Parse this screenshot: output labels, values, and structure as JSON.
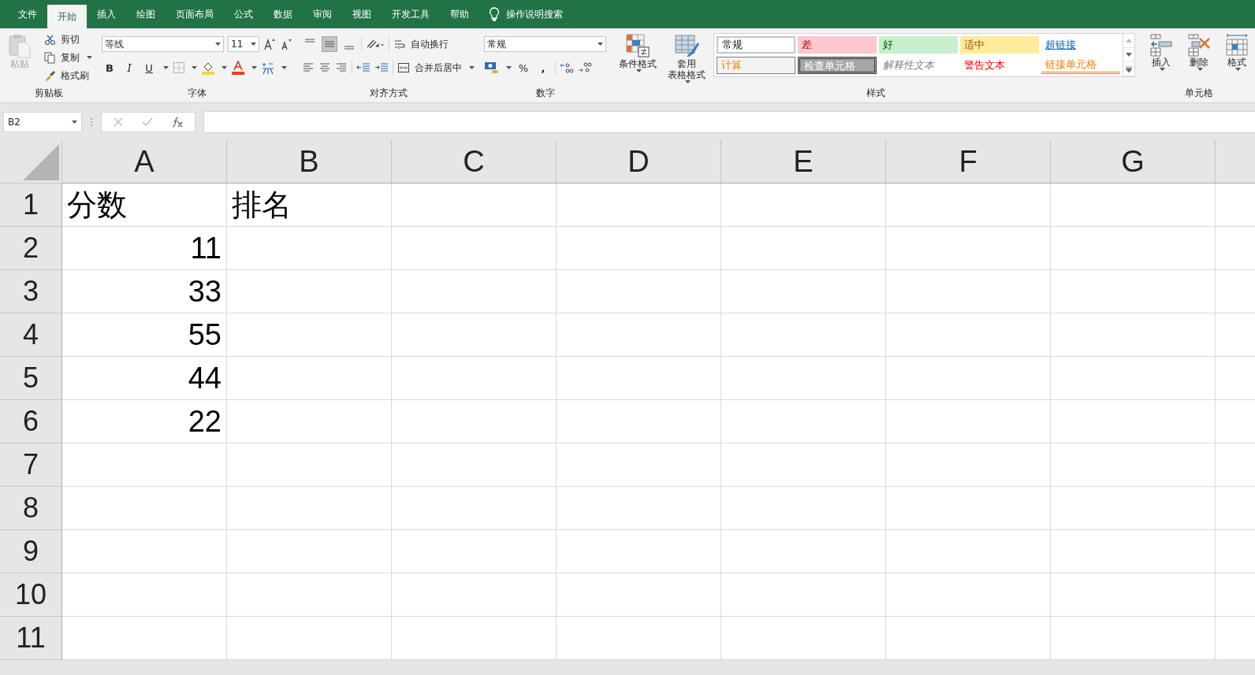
{
  "tabs": [
    {
      "label": "文件",
      "selected": false
    },
    {
      "label": "开始",
      "selected": true
    },
    {
      "label": "插入",
      "selected": false
    },
    {
      "label": "绘图",
      "selected": false
    },
    {
      "label": "页面布局",
      "selected": false
    },
    {
      "label": "公式",
      "selected": false
    },
    {
      "label": "数据",
      "selected": false
    },
    {
      "label": "审阅",
      "selected": false
    },
    {
      "label": "视图",
      "selected": false
    },
    {
      "label": "开发工具",
      "selected": false
    },
    {
      "label": "帮助",
      "selected": false
    }
  ],
  "tell_me": "操作说明搜索",
  "clipboard": {
    "label": "剪贴板",
    "paste": {
      "label": "粘贴",
      "disabled": true
    },
    "cut": "剪切",
    "copy": "复制",
    "format_painter": "格式刷"
  },
  "font": {
    "label": "字体",
    "name": "等线",
    "size": "11",
    "bold": "B",
    "italic": "I",
    "underline": "U"
  },
  "alignment": {
    "label": "对齐方式",
    "wrap": "自动换行",
    "merge": "合并后居中",
    "vertical": [
      {
        "selected": false
      },
      {
        "selected": true
      },
      {
        "selected": false
      }
    ]
  },
  "number": {
    "label": "数字",
    "format": "常规",
    "percent": "%",
    "comma": ","
  },
  "styles": {
    "label": "样式",
    "conditional": "条件格式",
    "table_lines": [
      "套用",
      "表格格式"
    ],
    "cell_styles": [
      {
        "text": "常规",
        "kind": "normal"
      },
      {
        "text": "差",
        "kind": "bad"
      },
      {
        "text": "好",
        "kind": "good"
      },
      {
        "text": "适中",
        "kind": "neutral"
      },
      {
        "text": "超链接",
        "kind": "hyperlink"
      },
      {
        "text": "计算",
        "kind": "calculation"
      },
      {
        "text": "检查单元格",
        "kind": "check"
      },
      {
        "text": "解释性文本",
        "kind": "explanatory"
      },
      {
        "text": "警告文本",
        "kind": "warning"
      },
      {
        "text": "链接单元格",
        "kind": "linked"
      }
    ]
  },
  "cells": {
    "label": "单元格",
    "insert": "插入",
    "delete": "删除",
    "format": "格式"
  },
  "name_box": "B2",
  "columns": [
    "A",
    "B",
    "C",
    "D",
    "E",
    "F",
    "G"
  ],
  "rows": [
    {
      "number": "1",
      "cells": [
        {
          "text": "分数",
          "kind": "text"
        },
        {
          "text": "排名",
          "kind": "text"
        }
      ]
    },
    {
      "number": "2",
      "cells": [
        {
          "text": "11",
          "kind": "number"
        }
      ]
    },
    {
      "number": "3",
      "cells": [
        {
          "text": "33",
          "kind": "number"
        }
      ]
    },
    {
      "number": "4",
      "cells": [
        {
          "text": "55",
          "kind": "number"
        }
      ]
    },
    {
      "number": "5",
      "cells": [
        {
          "text": "44",
          "kind": "number"
        }
      ]
    },
    {
      "number": "6",
      "cells": [
        {
          "text": "22",
          "kind": "number"
        }
      ]
    },
    {
      "number": "7",
      "cells": []
    },
    {
      "number": "8",
      "cells": []
    },
    {
      "number": "9",
      "cells": []
    },
    {
      "number": "10",
      "cells": []
    },
    {
      "number": "11",
      "cells": []
    }
  ]
}
